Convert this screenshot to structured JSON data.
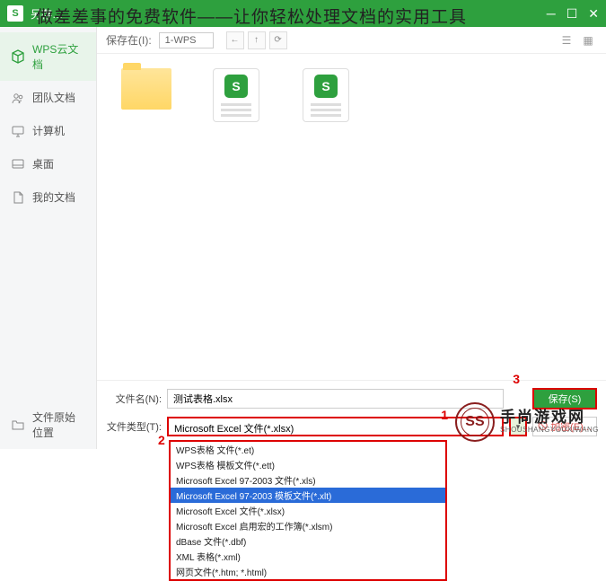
{
  "titlebar": {
    "app_badge": "S",
    "title": "另存…"
  },
  "overlay_heading": "做差差事的免费软件——让你轻松处理文档的实用工具",
  "sidebar": {
    "items": [
      {
        "label": "WPS云文档",
        "icon": "cube-icon"
      },
      {
        "label": "团队文档",
        "icon": "team-icon"
      },
      {
        "label": "计算机",
        "icon": "computer-icon"
      },
      {
        "label": "桌面",
        "icon": "desktop-icon"
      },
      {
        "label": "我的文档",
        "icon": "mydocs-icon"
      }
    ],
    "bottom": {
      "label": "文件原始位置",
      "icon": "folder-icon"
    }
  },
  "toolbar": {
    "location_label": "保存在(I):",
    "location_value": "1-WPS"
  },
  "form": {
    "filename_label": "文件名(N):",
    "filename_value": "测试表格.xlsx",
    "filetype_label": "文件类型(T):",
    "filetype_value": "Microsoft Excel 文件(*.xlsx)",
    "save_label": "保存(S)",
    "encrypt_label": "加密(E)..."
  },
  "markers": {
    "one": "1",
    "two": "2",
    "three": "3"
  },
  "dropdown": {
    "options": [
      "WPS表格 文件(*.et)",
      "WPS表格 模板文件(*.ett)",
      "Microsoft Excel 97-2003 文件(*.xls)",
      "Microsoft Excel 97-2003 模板文件(*.xlt)",
      "Microsoft Excel 文件(*.xlsx)",
      "Microsoft Excel 启用宏的工作簿(*.xlsm)",
      "dBase 文件(*.dbf)",
      "XML 表格(*.xml)",
      "网页文件(*.htm; *.html)"
    ],
    "selected_index": 3
  },
  "watermark": {
    "logo": "SS",
    "cn": "手尚游戏网",
    "en": "SHOUSHANGYOUXIWANG"
  }
}
